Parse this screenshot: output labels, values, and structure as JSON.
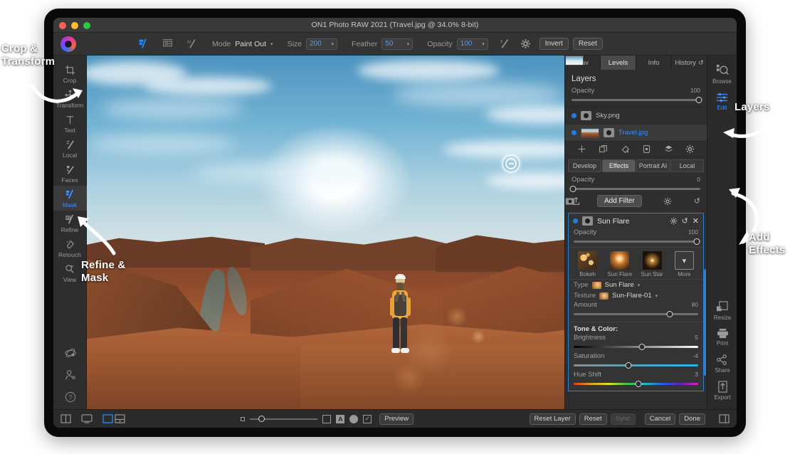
{
  "window": {
    "title": "ON1 Photo RAW 2021 (Travel.jpg @ 34.0% 8-bit)"
  },
  "toolbar": {
    "tools": [
      {
        "name": "mask-brush-tool",
        "active": true
      },
      {
        "name": "gradient-mask-tool",
        "active": false
      },
      {
        "name": "ai-mask-tool",
        "active": false
      }
    ],
    "mode_label": "Mode",
    "mode_value": "Paint Out",
    "size_label": "Size",
    "size_value": "200",
    "feather_label": "Feather",
    "feather_value": "50",
    "opacity_label": "Opacity",
    "opacity_value": "100",
    "invert_label": "Invert",
    "reset_label": "Reset"
  },
  "left_rail": {
    "items": [
      {
        "label": "Crop",
        "icon": "crop-icon",
        "active": false
      },
      {
        "label": "Transform",
        "icon": "transform-icon",
        "active": false
      },
      {
        "label": "Text",
        "icon": "text-icon",
        "active": false
      },
      {
        "label": "Local",
        "icon": "local-adjust-icon",
        "active": false
      },
      {
        "label": "Faces",
        "icon": "faces-icon",
        "active": false
      },
      {
        "label": "Mask",
        "icon": "mask-icon",
        "active": true
      },
      {
        "label": "Refine",
        "icon": "refine-icon",
        "active": false
      },
      {
        "label": "Retouch",
        "icon": "retouch-icon",
        "active": false
      },
      {
        "label": "View",
        "icon": "view-zoom-icon",
        "active": false
      }
    ],
    "bottom_icons": [
      "presets-icon",
      "portrait-person-icon",
      "help-icon"
    ]
  },
  "right_panel": {
    "tabs": [
      {
        "label": "Nav",
        "active": false
      },
      {
        "label": "Levels",
        "active": true
      },
      {
        "label": "Info",
        "active": false
      },
      {
        "label": "History",
        "active": false
      }
    ],
    "layers_title": "Layers",
    "layers_opacity_label": "Opacity",
    "layers_opacity_value": "100",
    "layers": [
      {
        "name": "Sky.png",
        "visible": true,
        "selected": false
      },
      {
        "name": "Travel.jpg",
        "visible": true,
        "selected": true
      }
    ],
    "layer_action_icons": [
      "add-layer-icon",
      "copy-layer-icon",
      "fill-layer-icon",
      "delete-layer-icon",
      "merge-layers-icon",
      "layer-settings-icon"
    ],
    "module_tabs": [
      {
        "label": "Develop",
        "active": false
      },
      {
        "label": "Effects",
        "active": true
      },
      {
        "label": "Portrait AI",
        "active": false
      },
      {
        "label": "Local",
        "active": false
      }
    ],
    "module_opacity_label": "Opacity",
    "module_opacity_value": "0",
    "add_filter_label": "Add Filter",
    "filter": {
      "title": "Sun Flare",
      "opacity_label": "Opacity",
      "opacity_value": "100",
      "presets": [
        {
          "label": "Bokeh",
          "style": "bokeh"
        },
        {
          "label": "Sun Flare",
          "style": "flare"
        },
        {
          "label": "Sun Star",
          "style": "star"
        },
        {
          "label": "More",
          "style": "more"
        }
      ],
      "type_label": "Type",
      "type_value": "Sun Flare",
      "texture_label": "Texture",
      "texture_value": "Sun-Flare-01",
      "amount_label": "Amount",
      "amount_value": "80",
      "tone_section_title": "Tone & Color:",
      "sliders": [
        {
          "label": "Brightness",
          "value": "5",
          "pct": 55,
          "track": "bright"
        },
        {
          "label": "Saturation",
          "value": "-4",
          "pct": 44,
          "track": "sat"
        },
        {
          "label": "Hue Shift",
          "value": "3",
          "pct": 52,
          "track": "hue"
        }
      ]
    }
  },
  "right_rail": {
    "top": [
      {
        "label": "Browse",
        "icon": "browse-icon",
        "active": false
      },
      {
        "label": "Edit",
        "icon": "edit-sliders-icon",
        "active": true
      }
    ],
    "bottom": [
      {
        "label": "Resize",
        "icon": "resize-icon"
      },
      {
        "label": "Print",
        "icon": "print-icon"
      },
      {
        "label": "Share",
        "icon": "share-icon"
      },
      {
        "label": "Export",
        "icon": "export-icon"
      }
    ]
  },
  "bottom_bar": {
    "left_icons": [
      "compare-view-icon",
      "single-view-icon",
      "filmstrip-view-icon"
    ],
    "zoom_small_icon": "zoom-out-icon",
    "right_icons": [
      "show-mask-icon",
      "show-clipping-icon",
      "soft-proof-icon",
      "checkmark-icon"
    ],
    "preview_label": "Preview",
    "buttons": [
      {
        "label": "Reset Layer",
        "disabled": false
      },
      {
        "label": "Reset",
        "disabled": false
      },
      {
        "label": "Sync",
        "disabled": true
      },
      {
        "label": "Cancel",
        "disabled": false
      },
      {
        "label": "Done",
        "disabled": false
      }
    ],
    "panel_toggle_icon": "panel-toggle-icon"
  },
  "annotations": [
    {
      "id": "crop-transform",
      "text": "Crop &\nTransform"
    },
    {
      "id": "refine-mask",
      "text": "Refine &\nMask"
    },
    {
      "id": "layers",
      "text": "Layers"
    },
    {
      "id": "add-effects",
      "text": "Add\nEffects"
    }
  ],
  "colors": {
    "accent": "#3b8dff",
    "panel": "#2e2e2e",
    "toolbar": "#333333"
  }
}
